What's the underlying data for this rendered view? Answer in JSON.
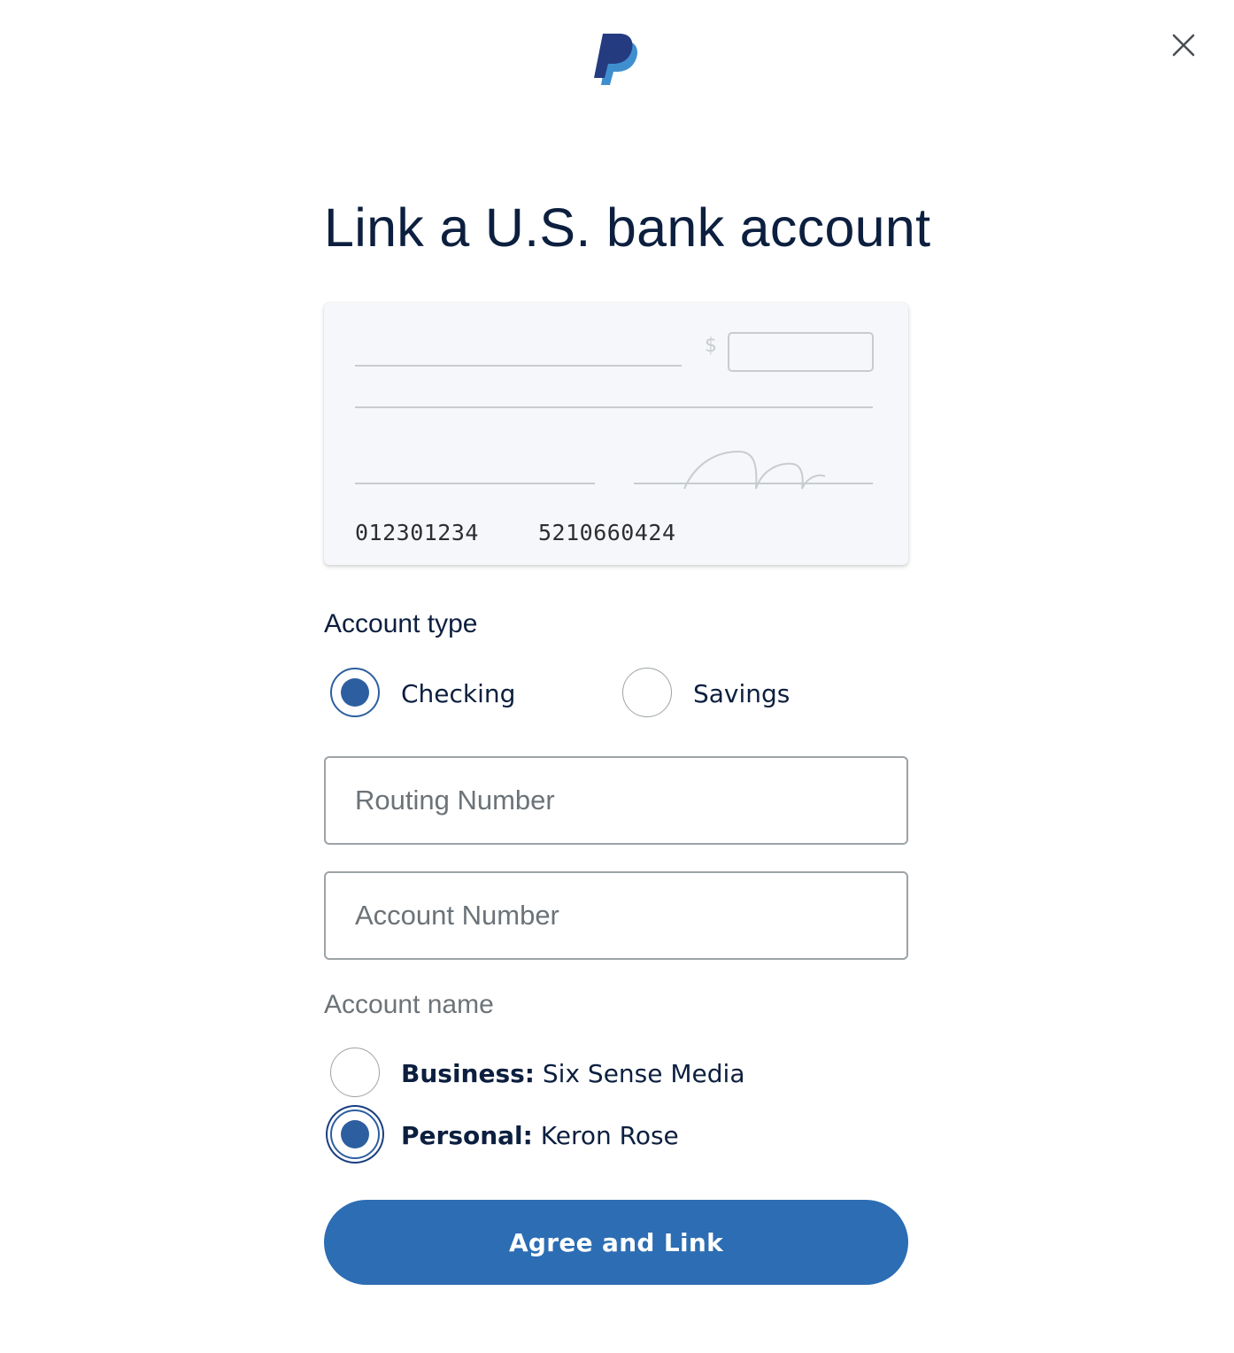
{
  "header": {
    "logo": "paypal-logo",
    "close_icon": "close-icon"
  },
  "title": "Link a U.S. bank account",
  "check_illustration": {
    "currency_symbol": "$",
    "routing_number": "012301234",
    "account_number": "5210660424"
  },
  "account_type": {
    "label": "Account type",
    "options": [
      {
        "label": "Checking",
        "selected": true
      },
      {
        "label": "Savings",
        "selected": false
      }
    ]
  },
  "routing_field": {
    "placeholder": "Routing Number",
    "value": ""
  },
  "account_field": {
    "placeholder": "Account Number",
    "value": ""
  },
  "account_name": {
    "label": "Account name",
    "options": [
      {
        "type": "Business:",
        "name": "Six Sense Media",
        "selected": false
      },
      {
        "type": "Personal:",
        "name": "Keron Rose",
        "selected": true
      }
    ]
  },
  "submit_label": "Agree and Link",
  "colors": {
    "brand_dark": "#253b80",
    "brand_light": "#179bd7",
    "accent": "#2c6db4",
    "heading": "#0c1f3f"
  }
}
